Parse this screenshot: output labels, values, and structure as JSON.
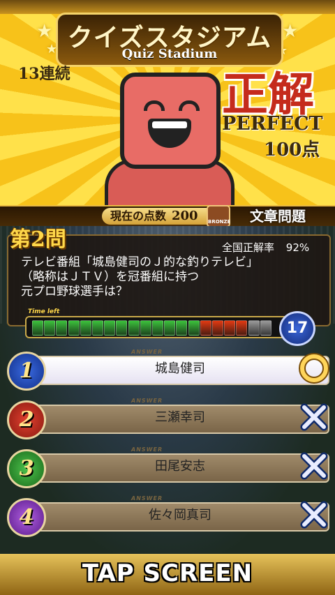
{
  "header": {
    "title_jp": "クイズスタジアム",
    "title_en": "Quiz Stadium",
    "streak": "13連続",
    "result": "正解",
    "grade": "PERFECT",
    "points_gained": "100点"
  },
  "scorebar": {
    "label": "現在の点数",
    "score": "200",
    "rank_badge": "BRONZE",
    "category": "文章問題"
  },
  "question": {
    "number": "第2問",
    "rate_label": "全国正解率",
    "rate_value": "92%",
    "line1": "テレビ番組「城島健司のＪ的な釣りテレビ」",
    "line2": "（略称はＪＴＶ）を冠番組に持つ",
    "line3": "元プロ野球選手は？"
  },
  "timer": {
    "label": "Time left",
    "seconds": "17",
    "segments_total": 20,
    "segments_green": 14,
    "segments_red": 4,
    "colors": {
      "green": "#3cc23c",
      "red": "#e23a12",
      "gray": "#9a9a9a"
    }
  },
  "answers": [
    {
      "num": "1",
      "tag": "ANSWER",
      "text": "城島健司",
      "result": "correct"
    },
    {
      "num": "2",
      "tag": "ANSWER",
      "text": "三瀬幸司",
      "result": "wrong"
    },
    {
      "num": "3",
      "tag": "ANSWER",
      "text": "田尾安志",
      "result": "wrong"
    },
    {
      "num": "4",
      "tag": "ANSWER",
      "text": "佐々岡真司",
      "result": "wrong"
    }
  ],
  "footer": {
    "tap": "TAP SCREEN"
  }
}
